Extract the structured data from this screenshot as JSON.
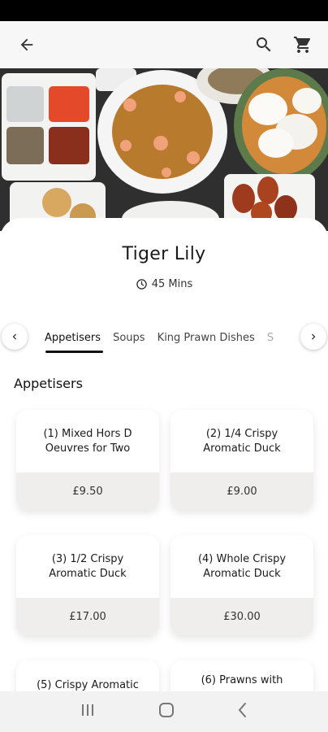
{
  "restaurant": {
    "name": "Tiger Lily",
    "delivery_time": "45 Mins"
  },
  "tabs": [
    {
      "label": "Appetisers",
      "active": true
    },
    {
      "label": "Soups",
      "active": false
    },
    {
      "label": "King Prawn Dishes",
      "active": false
    },
    {
      "label": "S",
      "active": false
    }
  ],
  "section": {
    "title": "Appetisers"
  },
  "items": [
    {
      "name": "(1) Mixed Hors D Oeuvres for Two",
      "price": "£9.50"
    },
    {
      "name": "(2) 1/4 Crispy Aromatic Duck",
      "price": "£9.00"
    },
    {
      "name": "(3) 1/2 Crispy Aromatic Duck",
      "price": "£17.00"
    },
    {
      "name": "(4) Whole Crispy Aromatic Duck",
      "price": "£30.00"
    },
    {
      "name": "(5) Crispy Aromatic",
      "price": ""
    },
    {
      "name": "(6) Prawns with",
      "price": ""
    }
  ],
  "icons": {
    "back": "arrow-left-icon",
    "search": "search-icon",
    "cart": "cart-icon",
    "clock": "clock-icon"
  }
}
